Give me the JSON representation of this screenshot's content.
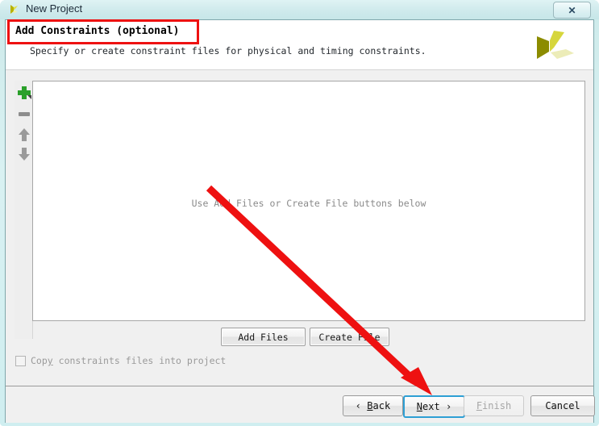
{
  "window": {
    "title": "New Project",
    "icon": "vivado-logo-icon",
    "close_label": "✕"
  },
  "header": {
    "title": "Add Constraints (optional)",
    "subtitle": "Specify or create constraint files for physical and timing constraints.",
    "logo": "xilinx-vivado-logo"
  },
  "toolbar": {
    "items": [
      {
        "name": "add-icon",
        "glyph": "+"
      },
      {
        "name": "remove-icon",
        "glyph": "−"
      },
      {
        "name": "move-up-icon",
        "glyph": "↑"
      },
      {
        "name": "move-down-icon",
        "glyph": "↓"
      }
    ]
  },
  "list": {
    "empty_hint": "Use Add Files or Create File buttons below",
    "items": []
  },
  "file_buttons": {
    "add_files": "Add Files",
    "create_file": "Create File"
  },
  "options": {
    "copy_constraints": {
      "label_pre": "Cop",
      "label_mnemonic": "y",
      "label_post": " constraints files into project",
      "checked": false,
      "enabled": false
    }
  },
  "nav": {
    "back": {
      "arrow": "‹",
      "label_mnemonic": "B",
      "label_rest": "ack"
    },
    "next": {
      "label_mnemonic": "N",
      "label_rest": "ext",
      "arrow": "›",
      "focused": true
    },
    "finish": {
      "label_mnemonic": "F",
      "label_rest": "inish",
      "enabled": false
    },
    "cancel": {
      "label": "Cancel"
    }
  },
  "annotations": {
    "highlight_box": "red-rect-around-header-title",
    "arrow": "red-arrow-to-next-button",
    "accent_color": "#ee1111"
  }
}
